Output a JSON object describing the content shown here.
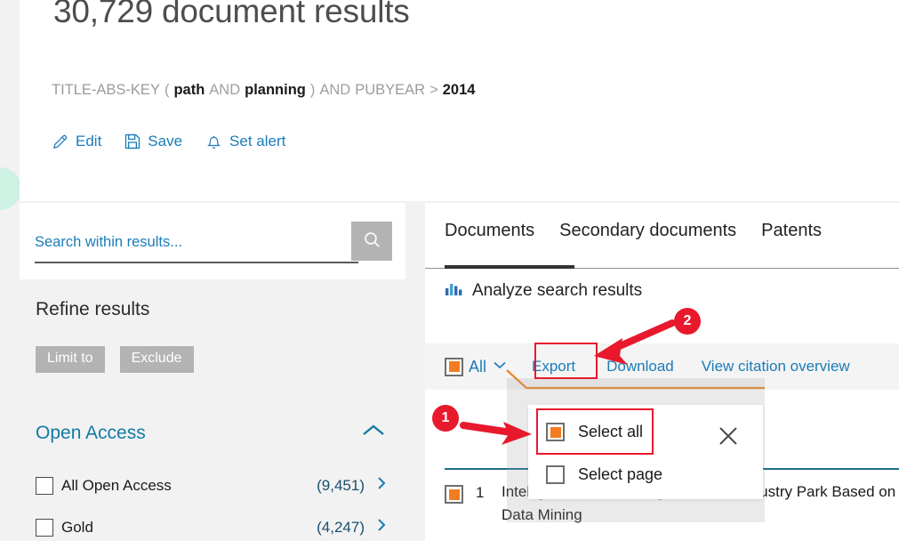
{
  "header": {
    "result_count": "30,729 document results",
    "query": [
      {
        "text": "TITLE-ABS-KEY",
        "kind": "field"
      },
      {
        "text": "(",
        "kind": "paren"
      },
      {
        "text": "path",
        "kind": "term"
      },
      {
        "text": "AND",
        "kind": "op"
      },
      {
        "text": "planning",
        "kind": "term"
      },
      {
        "text": ")",
        "kind": "paren"
      },
      {
        "text": "AND",
        "kind": "op"
      },
      {
        "text": "PUBYEAR",
        "kind": "field"
      },
      {
        "text": ">",
        "kind": "op"
      },
      {
        "text": "2014",
        "kind": "term"
      }
    ],
    "actions": [
      {
        "label": "Edit",
        "icon": "pencil-icon"
      },
      {
        "label": "Save",
        "icon": "floppy-disk-icon"
      },
      {
        "label": "Set alert",
        "icon": "bell-icon"
      }
    ]
  },
  "sidebar": {
    "search": {
      "placeholder": "Search within results...",
      "value": "",
      "button_icon": "search-icon"
    },
    "refine_title": "Refine results",
    "chips": [
      "Limit to",
      "Exclude"
    ],
    "facet": {
      "title": "Open Access",
      "collapse_icon": "chevron-up-icon",
      "rows": [
        {
          "label": "All Open Access",
          "count": "(9,451)",
          "chevron": "chevron-right-icon",
          "checked": false
        },
        {
          "label": "Gold",
          "count": "(4,247)",
          "chevron": "chevron-right-icon",
          "checked": false
        }
      ]
    }
  },
  "main": {
    "tabs": [
      {
        "label": "Documents",
        "active": true
      },
      {
        "label": "Secondary documents",
        "active": false
      },
      {
        "label": "Patents",
        "active": false
      }
    ],
    "analyze": {
      "label": "Analyze search results",
      "icon": "bar-chart-icon"
    },
    "toolbar": {
      "all_label": "All",
      "all_caret_icon": "chevron-down-icon",
      "all_checked": true,
      "export_label": "Export",
      "download_label": "Download",
      "citation_label": "View citation overview"
    },
    "dropdown": {
      "items": [
        {
          "label": "Select all",
          "checked": true
        },
        {
          "label": "Select page",
          "checked": false
        }
      ],
      "close_icon": "close-icon"
    },
    "result_row": {
      "number": "1",
      "checked": true,
      "title": "Intelligent Path Planning for Health Industry Park Based on Data Mining"
    }
  },
  "annotations": {
    "badges": [
      {
        "number": "1",
        "target": "select-all-option"
      },
      {
        "number": "2",
        "target": "export-button"
      }
    ],
    "highlight_color": "#e8192c"
  },
  "colors": {
    "link_blue": "#1a7cb8",
    "accent_orange": "#f47c20",
    "annotation_red": "#e8192c",
    "page_bg": "#f2f2f2",
    "toolbar_bg": "#f4f4f4",
    "chip_grey": "#b3b3b3",
    "mint": "#cdf2e4"
  }
}
